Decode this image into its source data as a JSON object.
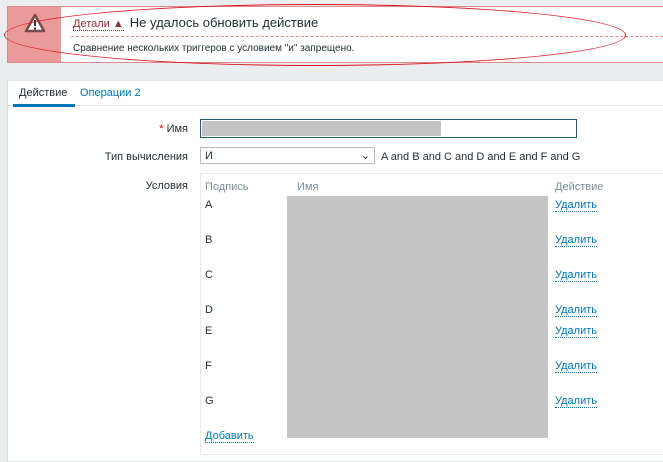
{
  "error": {
    "details_label": "Детали",
    "title": "Не удалось обновить действие",
    "message": "Сравнение нескольких триггеров с условием \"и\" запрещено."
  },
  "tabs": [
    {
      "label": "Действие"
    },
    {
      "label": "Операции 2"
    }
  ],
  "form": {
    "name_label": "Имя",
    "required_mark": "*",
    "calc_label": "Тип вычисления",
    "calc_value": "И",
    "expression": "A and B and C and D and E and F and G",
    "conditions_label": "Условия",
    "columns": {
      "label": "Подпись",
      "name": "Имя",
      "action": "Действие"
    },
    "conditions": [
      {
        "label": "A",
        "action": "Удалить"
      },
      {
        "label": "B",
        "action": "Удалить"
      },
      {
        "label": "C",
        "action": "Удалить"
      },
      {
        "label": "D",
        "action": "Удалить"
      },
      {
        "label": "E",
        "action": "Удалить"
      },
      {
        "label": "F",
        "action": "Удалить"
      },
      {
        "label": "G",
        "action": "Удалить"
      }
    ],
    "add_label": "Добавить"
  }
}
